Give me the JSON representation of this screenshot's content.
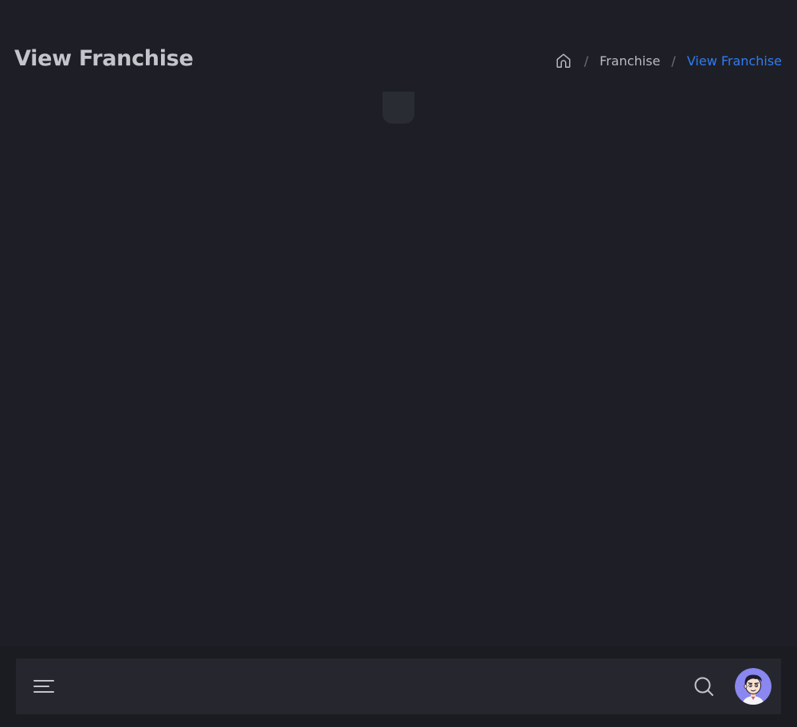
{
  "header": {
    "title": "View Franchise"
  },
  "breadcrumb": {
    "home_icon": "home-icon",
    "separator": "/",
    "items": [
      {
        "label": "Franchise"
      },
      {
        "label": "View Franchise"
      }
    ]
  },
  "bottom_bar": {
    "menu_icon": "hamburger-menu-icon",
    "search_icon": "search-icon",
    "avatar": "user-avatar"
  },
  "colors": {
    "background": "#1e1f26",
    "title": "#c4c5cb",
    "breadcrumb_link": "#b9bac0",
    "breadcrumb_active": "#2f7cf6",
    "bar": "#26272e",
    "avatar_bg": "#8a87f0"
  }
}
